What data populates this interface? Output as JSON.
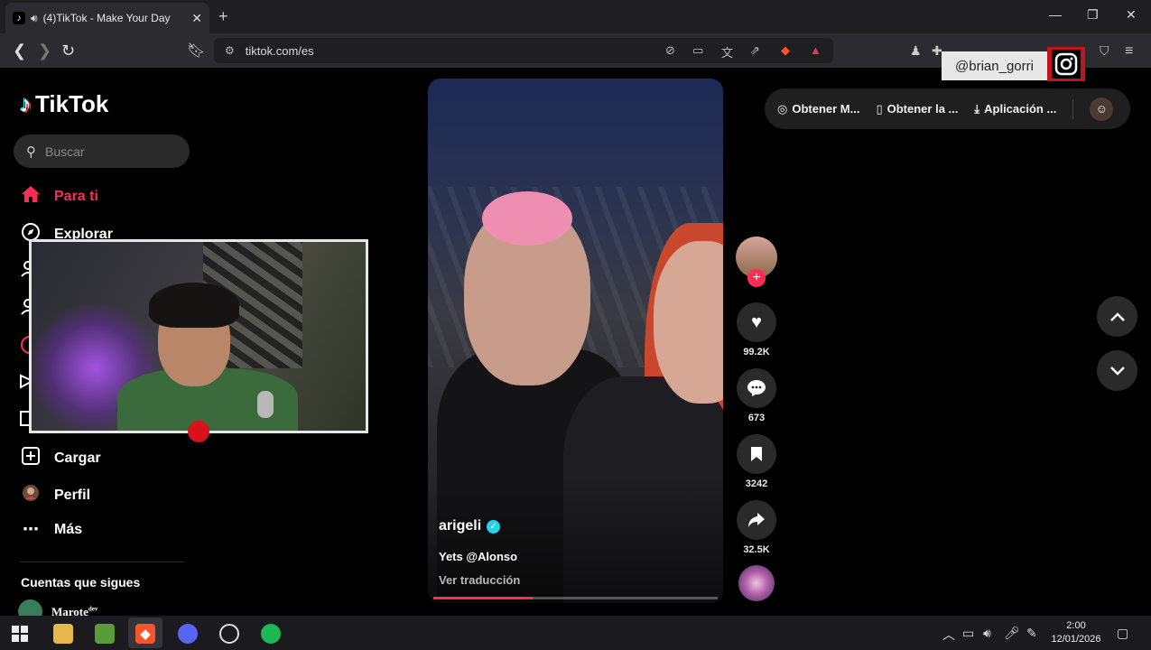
{
  "browser": {
    "tab_title": "(4)TikTok - Make Your Day",
    "tab_close": "✕",
    "new_tab": "+",
    "url": "tiktok.com/es",
    "window_controls": [
      "—",
      "❐",
      "✕"
    ]
  },
  "overlay": {
    "instagram_handle": "@brian_gorri"
  },
  "sidebar": {
    "brand": "TikTok",
    "search_placeholder": "Buscar",
    "items": [
      {
        "label": "Para ti",
        "icon": "home-icon",
        "active": true
      },
      {
        "label": "Explorar",
        "icon": "compass-icon",
        "active": false
      },
      {
        "label": "Cargar",
        "icon": "upload-icon",
        "active": false
      },
      {
        "label": "Perfil",
        "icon": "profile-avatar-icon",
        "active": false
      },
      {
        "label": "Más",
        "icon": "more-icon",
        "active": false
      }
    ],
    "following_title": "Cuentas que sigues",
    "following": [
      {
        "name": "Marote",
        "sup": "dev"
      }
    ]
  },
  "video": {
    "author": "arigeli",
    "caption": "Yets @Alonso",
    "translate": "Ver traducción",
    "progress": 0.35
  },
  "actions": {
    "likes": "99.2K",
    "comments": "673",
    "saves": "3242",
    "shares": "32.5K"
  },
  "top_pill": {
    "items": [
      {
        "label": "Obtener M...",
        "icon": "coin-icon"
      },
      {
        "label": "Obtener la ...",
        "icon": "phone-icon"
      },
      {
        "label": "Aplicación ...",
        "icon": "download-icon"
      }
    ]
  },
  "taskbar": {
    "time": "2:00",
    "date": "12/01/2026"
  },
  "colors": {
    "accent": "#fe2c55",
    "verified": "#20d5ec",
    "instagram_frame": "#c0141e"
  }
}
